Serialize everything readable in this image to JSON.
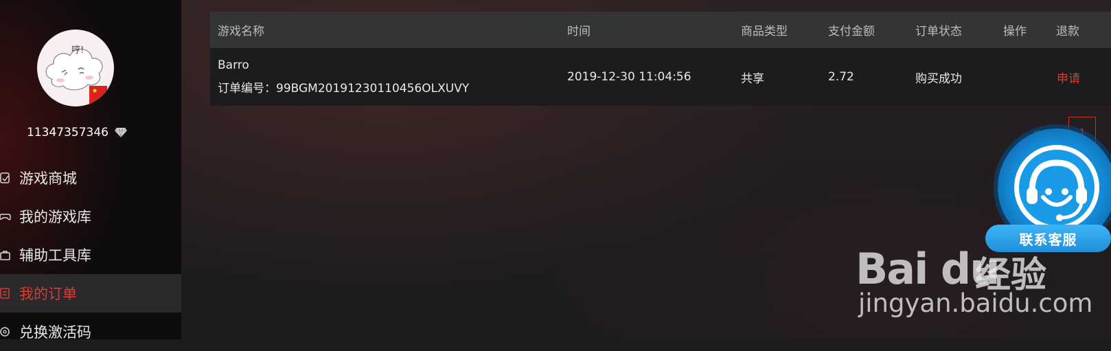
{
  "user": {
    "username": "11347357346"
  },
  "nav": {
    "items": [
      {
        "label": "游戏商城",
        "icon": "store-icon"
      },
      {
        "label": "我的游戏库",
        "icon": "gamepad-icon"
      },
      {
        "label": "辅助工具库",
        "icon": "toolbox-icon"
      },
      {
        "label": "我的订单",
        "icon": "order-icon",
        "active": true
      },
      {
        "label": "兑换激活码",
        "icon": "redeem-icon"
      }
    ]
  },
  "table": {
    "headers": {
      "game_name": "游戏名称",
      "time": "时间",
      "type": "商品类型",
      "amount": "支付金额",
      "status": "订单状态",
      "action": "操作",
      "refund": "退款"
    },
    "rows": [
      {
        "game": "Barro",
        "order_no": "订单编号：99BGM20191230110456OLXUVY",
        "time": "2019-12-30 11:04:56",
        "type": "共享",
        "amount": "2.72",
        "status": "购买成功",
        "refund": "申请"
      }
    ]
  },
  "pagination": {
    "prev": "<",
    "next": ">",
    "current": "1"
  },
  "support": {
    "label": "联系客服"
  },
  "watermark": {
    "logo": "Bai du",
    "cn": "经验",
    "url": "jingyan.baidu.com"
  },
  "colors": {
    "accent": "#e23a2a",
    "support_blue": "#1a9be8"
  }
}
